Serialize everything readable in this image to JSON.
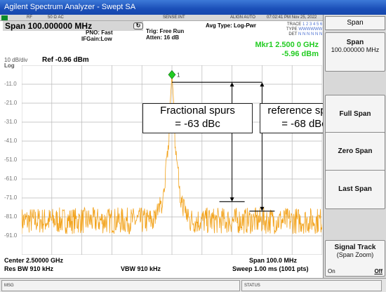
{
  "window": {
    "title": "Agilent Spectrum Analyzer - Swept SA"
  },
  "status_strip": {
    "rf": "RF",
    "ohm": "50 Ω  AC",
    "sense": "SENSE:INT",
    "align": "ALIGN AUTO",
    "clock": "07:02:41 PM Nov 25, 2022"
  },
  "header": {
    "span": "Span 100.000000 MHz",
    "pno": "PNO: Fast",
    "ifgain": "IFGain:Low",
    "trig": "Trig: Free Run",
    "atten": "Atten: 16 dB",
    "avg": "Avg Type: Log-Pwr",
    "trace_label": "TRACE",
    "trace_vals": "1 2 3 4 5 6",
    "type_label": "TYPE",
    "type_vals": "WWWWWW",
    "det_label": "DET",
    "det_vals": "N N N N N N"
  },
  "marker": {
    "line1": "Mkr1 2.500 0 GHz",
    "line2": "-5.96 dBm",
    "num": "1"
  },
  "scale": {
    "div": "10 dB/div",
    "log": "Log",
    "ref": "Ref -0.96 dBm"
  },
  "y_ticks": [
    "-11.0",
    "-21.0",
    "-31.0",
    "-41.0",
    "-51.0",
    "-61.0",
    "-71.0",
    "-81.0",
    "-91.0"
  ],
  "annotations": {
    "fractional": [
      "Fractional spurs",
      "= -63 dBc"
    ],
    "reference": [
      "reference spurs",
      "= -68 dBc"
    ]
  },
  "footer": {
    "center": "Center 2.50000 GHz",
    "res_bw": "Res BW 910 kHz",
    "vbw": "VBW 910 kHz",
    "span": "Span 100.0 MHz",
    "sweep": "Sweep  1.00 ms (1001 pts)"
  },
  "bottom": {
    "msg": "MSG",
    "status": "STATUS"
  },
  "softkeys": {
    "title": "Span",
    "span_label": "Span",
    "span_value": "100.000000 MHz",
    "full_span": "Full Span",
    "zero_span": "Zero Span",
    "last_span": "Last Span",
    "signal_track": "Signal Track",
    "signal_track_sub": "(Span Zoom)",
    "on": "On",
    "off": "Off"
  },
  "colors": {
    "trace": "#f2a21a",
    "marker": "#22cc22",
    "grid": "#b8b8b8"
  },
  "chart_data": {
    "type": "line",
    "y_unit": "dBm",
    "ylim": [
      -101,
      -1
    ],
    "x_center_ghz": 2.5,
    "x_span_mhz": 100,
    "peak": {
      "x_ghz": 2.5,
      "y": -5.96
    },
    "fractional_spur_dbc": -63,
    "reference_spur_dbc": -68
  }
}
